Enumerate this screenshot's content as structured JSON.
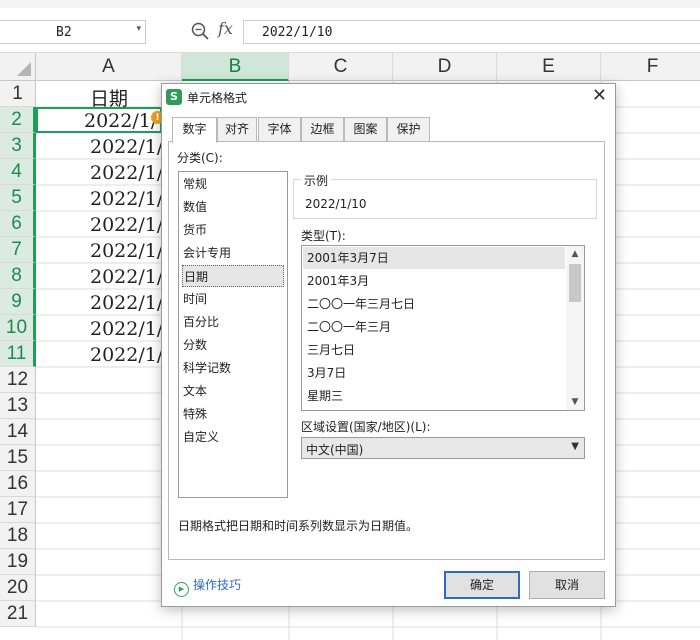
{
  "formula_bar": {
    "name_box": "B2",
    "fx_label": "fx",
    "formula": "2022/1/10",
    "icons": [
      "zoom-icon",
      "dropdown-arrow-icon"
    ]
  },
  "sheet": {
    "columns": [
      "A",
      "B",
      "C",
      "D",
      "E",
      "F"
    ],
    "selected_column": "B",
    "rows": [
      "1",
      "2",
      "3",
      "4",
      "5",
      "6",
      "7",
      "8",
      "9",
      "10",
      "11",
      "12",
      "13",
      "14",
      "15",
      "16",
      "17",
      "18",
      "19",
      "20",
      "21"
    ],
    "cells_a": [
      "日期",
      "2022/1/",
      "2022/1/",
      "2022/1/",
      "2022/1/",
      "2022/1/",
      "2022/1/",
      "2022/1/",
      "2022/1/",
      "2022/1/",
      "2022/1/"
    ],
    "accent": "#1f9e58"
  },
  "dialog": {
    "title": "单元格格式",
    "logo": "S",
    "tabs": [
      "数字",
      "对齐",
      "字体",
      "边框",
      "图案",
      "保护"
    ],
    "active_tab": "数字",
    "category_label": "分类(C):",
    "categories": [
      "常规",
      "数值",
      "货币",
      "会计专用",
      "日期",
      "时间",
      "百分比",
      "分数",
      "科学记数",
      "文本",
      "特殊",
      "自定义"
    ],
    "selected_category": "日期",
    "sample_legend": "示例",
    "sample_value": "2022/1/10",
    "type_label": "类型(T):",
    "types": [
      "2001年3月7日",
      "2001年3月",
      "二〇〇一年三月七日",
      "二〇〇一年三月",
      "三月七日",
      "3月7日",
      "星期三"
    ],
    "selected_type": "2001年3月7日",
    "locale_label": "区域设置(国家/地区)(L):",
    "locale_value": "中文(中国)",
    "description": "日期格式把日期和时间系列数显示为日期值。",
    "tips": "操作技巧",
    "ok": "确定",
    "cancel": "取消"
  }
}
